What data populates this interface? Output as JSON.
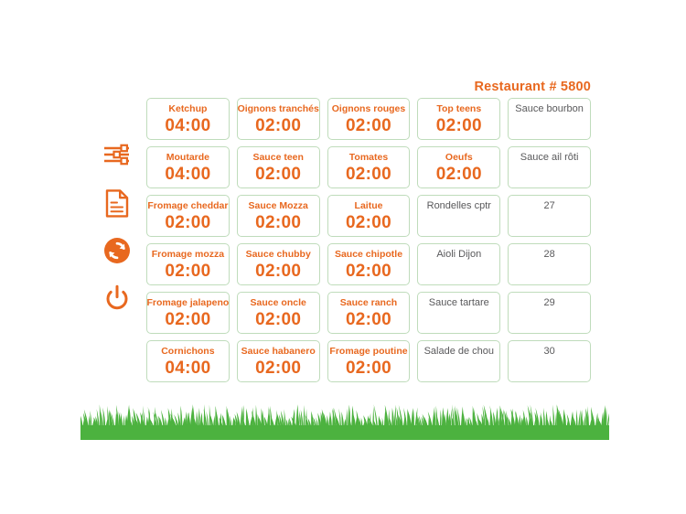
{
  "header": {
    "title": "Restaurant # 5800",
    "accent_color": "#e8681f"
  },
  "sidebar": {
    "items": [
      {
        "icon": "sliders-icon",
        "name": "settings"
      },
      {
        "icon": "document-icon",
        "name": "report"
      },
      {
        "icon": "refresh-icon",
        "name": "sync"
      },
      {
        "icon": "power-icon",
        "name": "power"
      }
    ]
  },
  "colors": {
    "orange": "#e8681f",
    "card_border": "#bfdcbb",
    "gray_text": "#59595b",
    "grass_green": "#4cb23f"
  },
  "grid": {
    "columns": 5,
    "rows": 6,
    "cells": [
      {
        "label": "Ketchup",
        "time": "04:00",
        "kind": "timer"
      },
      {
        "label": "Oignons tranchés",
        "time": "02:00",
        "kind": "timer"
      },
      {
        "label": "Oignons rouges",
        "time": "02:00",
        "kind": "timer"
      },
      {
        "label": "Top teens",
        "time": "02:00",
        "kind": "timer"
      },
      {
        "label": "Sauce bourbon",
        "time": "",
        "kind": "plain"
      },
      {
        "label": "Moutarde",
        "time": "04:00",
        "kind": "timer"
      },
      {
        "label": "Sauce teen",
        "time": "02:00",
        "kind": "timer"
      },
      {
        "label": "Tomates",
        "time": "02:00",
        "kind": "timer"
      },
      {
        "label": "Oeufs",
        "time": "02:00",
        "kind": "timer"
      },
      {
        "label": "Sauce ail rôti",
        "time": "",
        "kind": "plain"
      },
      {
        "label": "Fromage cheddar",
        "time": "02:00",
        "kind": "timer"
      },
      {
        "label": "Sauce Mozza",
        "time": "02:00",
        "kind": "timer"
      },
      {
        "label": "Laitue",
        "time": "02:00",
        "kind": "timer"
      },
      {
        "label": "Rondelles cptr",
        "time": "",
        "kind": "plain"
      },
      {
        "label": "27",
        "time": "",
        "kind": "plain"
      },
      {
        "label": "Fromage mozza",
        "time": "02:00",
        "kind": "timer"
      },
      {
        "label": "Sauce chubby",
        "time": "02:00",
        "kind": "timer"
      },
      {
        "label": "Sauce chipotle",
        "time": "02:00",
        "kind": "timer"
      },
      {
        "label": "Aioli Dijon",
        "time": "",
        "kind": "plain"
      },
      {
        "label": "28",
        "time": "",
        "kind": "plain"
      },
      {
        "label": "Fromage jalapeno",
        "time": "02:00",
        "kind": "timer"
      },
      {
        "label": "Sauce oncle",
        "time": "02:00",
        "kind": "timer"
      },
      {
        "label": "Sauce ranch",
        "time": "02:00",
        "kind": "timer"
      },
      {
        "label": "Sauce tartare",
        "time": "",
        "kind": "plain"
      },
      {
        "label": "29",
        "time": "",
        "kind": "plain"
      },
      {
        "label": "Cornichons",
        "time": "04:00",
        "kind": "timer"
      },
      {
        "label": "Sauce habanero",
        "time": "02:00",
        "kind": "timer"
      },
      {
        "label": "Fromage poutine",
        "time": "02:00",
        "kind": "timer"
      },
      {
        "label": "Salade de chou",
        "time": "",
        "kind": "plain"
      },
      {
        "label": "30",
        "time": "",
        "kind": "plain"
      }
    ]
  }
}
